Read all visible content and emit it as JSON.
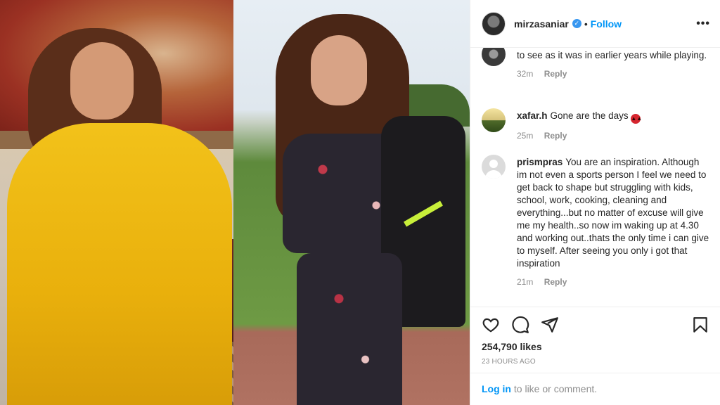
{
  "post": {
    "username": "mirzasaniar",
    "verified_icon": "verified-badge-icon",
    "separator": "•",
    "follow_label": "Follow",
    "more_label": "•••"
  },
  "comments": [
    {
      "user": "",
      "text": "to see as it was in earlier years while playing.",
      "time": "32m",
      "reply": "Reply"
    },
    {
      "user": "xafar.h",
      "text": "Gone are the days",
      "emoji": "😈",
      "time": "25m",
      "reply": "Reply"
    },
    {
      "user": "prismpras",
      "text": "You are an inspiration. Although im not even a sports person I feel we need to get back to shape but struggling with kids, school, work, cooking, cleaning and everything...but no matter of excuse will give me my health..so now im waking up at 4.30 and working out..thats the only time i can give to myself. After seeing you only i got that inspiration",
      "time": "21m",
      "reply": "Reply"
    }
  ],
  "actions": {
    "icons": [
      "heart-icon",
      "comment-icon",
      "share-icon",
      "bookmark-icon"
    ],
    "likes": "254,790 likes",
    "timestamp": "23 HOURS AGO"
  },
  "login": {
    "link": "Log in",
    "rest": " to like or comment."
  },
  "colors": {
    "accent": "#0095f6",
    "text": "#262626",
    "muted": "#8e8e8e",
    "border": "#efefef"
  }
}
